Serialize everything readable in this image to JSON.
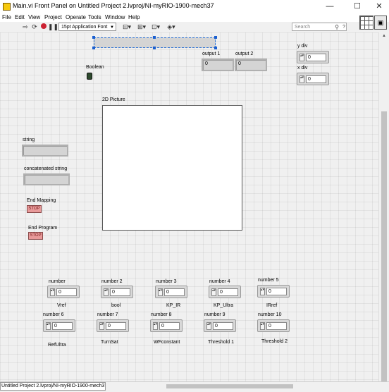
{
  "window": {
    "title": "Main.vi Front Panel on Untitled Project 2.lvproj/NI-myRIO-1900-mech37",
    "minimize": "—",
    "maximize": "☐",
    "close": "✕"
  },
  "menu": [
    "File",
    "Edit",
    "View",
    "Project",
    "Operate",
    "Tools",
    "Window",
    "Help"
  ],
  "toolbar": {
    "font": "15pt Application Font",
    "search_placeholder": "Search",
    "icons": [
      "run-arrow-icon",
      "run-continuously-icon",
      "abort-icon",
      "pause-icon",
      "align-icon",
      "distribute-icon",
      "resize-icon",
      "reorder-icon"
    ]
  },
  "panel": {
    "boolean_label": "Boolean",
    "output1_label": "output 1",
    "output1_value": "0",
    "output2_label": "output 2",
    "output2_value": "0",
    "ydiv_label": "y div",
    "ydiv_value": "0",
    "xdiv_label": "x div",
    "xdiv_value": "0",
    "picture_label": "2D Picture",
    "string_label": "string",
    "concat_label": "concatenated string",
    "end_mapping_label": "End Mapping",
    "end_program_label": "End Program",
    "stop_text": "STOP",
    "numbers": [
      {
        "label": "number",
        "value": "0",
        "caption": "Vref"
      },
      {
        "label": "number 2",
        "value": "0",
        "caption": "bool"
      },
      {
        "label": "number 3",
        "value": "0",
        "caption": "KP_IR"
      },
      {
        "label": "number 4",
        "value": "0",
        "caption": "KP_Ultra"
      },
      {
        "label": "number 5",
        "value": "0",
        "caption": "IRref"
      },
      {
        "label": "number 6",
        "value": "0",
        "caption": "RefUltra"
      },
      {
        "label": "number 7",
        "value": "0",
        "caption": "TurnSat"
      },
      {
        "label": "number 8",
        "value": "0",
        "caption": "WFconstant"
      },
      {
        "label": "number 9",
        "value": "0",
        "caption": "Threshold 1"
      },
      {
        "label": "number 10",
        "value": "0",
        "caption": "Threshold 2"
      }
    ]
  },
  "status": {
    "target": "Untitled Project 2.lvproj/NI-myRIO-1900-mech37"
  }
}
